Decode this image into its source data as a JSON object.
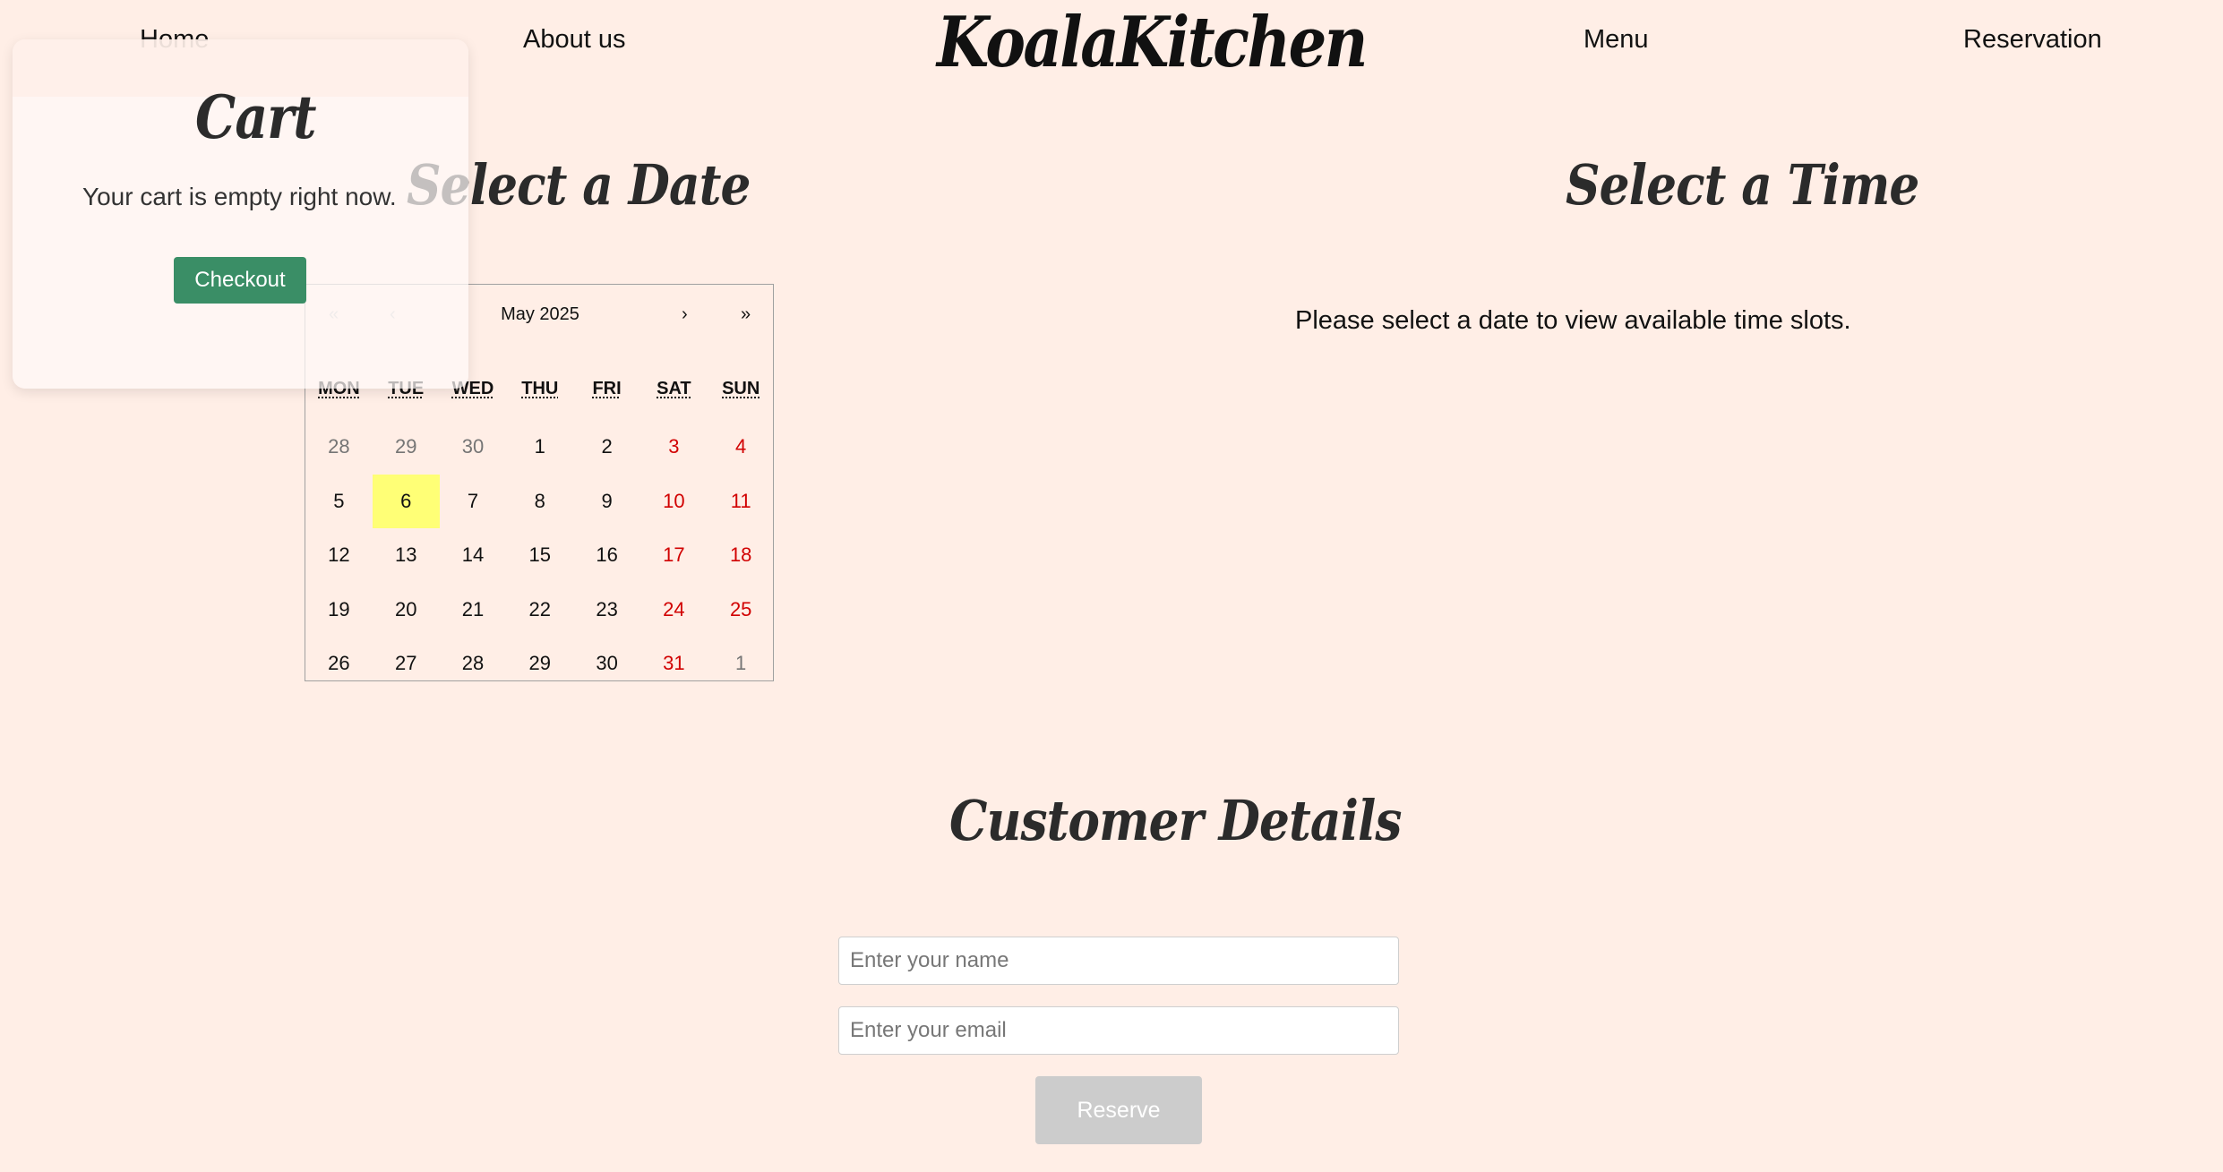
{
  "header": {
    "brand": "KoalaKitchen",
    "nav": {
      "home": "Home",
      "about": "About us",
      "menu": "Menu",
      "reservation": "Reservation"
    }
  },
  "date_section": {
    "title": "Select a Date"
  },
  "time_section": {
    "title": "Select a Time",
    "message": "Please select a date to view available time slots."
  },
  "calendar": {
    "month_label": "May 2025",
    "nav": {
      "prev_year": "«",
      "prev_month": "‹",
      "next_month": "›",
      "next_year": "»"
    },
    "weekdays": [
      "MON",
      "TUE",
      "WED",
      "THU",
      "FRI",
      "SAT",
      "SUN"
    ],
    "days": [
      {
        "label": "28",
        "kind": "other"
      },
      {
        "label": "29",
        "kind": "other"
      },
      {
        "label": "30",
        "kind": "other"
      },
      {
        "label": "1",
        "kind": "normal"
      },
      {
        "label": "2",
        "kind": "normal"
      },
      {
        "label": "3",
        "kind": "weekend"
      },
      {
        "label": "4",
        "kind": "weekend"
      },
      {
        "label": "5",
        "kind": "normal"
      },
      {
        "label": "6",
        "kind": "today"
      },
      {
        "label": "7",
        "kind": "normal"
      },
      {
        "label": "8",
        "kind": "normal"
      },
      {
        "label": "9",
        "kind": "normal"
      },
      {
        "label": "10",
        "kind": "weekend"
      },
      {
        "label": "11",
        "kind": "weekend"
      },
      {
        "label": "12",
        "kind": "normal"
      },
      {
        "label": "13",
        "kind": "normal"
      },
      {
        "label": "14",
        "kind": "normal"
      },
      {
        "label": "15",
        "kind": "normal"
      },
      {
        "label": "16",
        "kind": "normal"
      },
      {
        "label": "17",
        "kind": "weekend"
      },
      {
        "label": "18",
        "kind": "weekend"
      },
      {
        "label": "19",
        "kind": "normal"
      },
      {
        "label": "20",
        "kind": "normal"
      },
      {
        "label": "21",
        "kind": "normal"
      },
      {
        "label": "22",
        "kind": "normal"
      },
      {
        "label": "23",
        "kind": "normal"
      },
      {
        "label": "24",
        "kind": "weekend"
      },
      {
        "label": "25",
        "kind": "weekend"
      },
      {
        "label": "26",
        "kind": "normal"
      },
      {
        "label": "27",
        "kind": "normal"
      },
      {
        "label": "28",
        "kind": "normal"
      },
      {
        "label": "29",
        "kind": "normal"
      },
      {
        "label": "30",
        "kind": "normal"
      },
      {
        "label": "31",
        "kind": "weekend"
      },
      {
        "label": "1",
        "kind": "other"
      }
    ]
  },
  "cart": {
    "title": "Cart",
    "empty_message": "Your cart is empty right now.",
    "checkout_label": "Checkout"
  },
  "customer": {
    "title": "Customer Details",
    "name_placeholder": "Enter your name",
    "email_placeholder": "Enter your email",
    "reserve_label": "Reserve"
  },
  "colors": {
    "background": "#ffeee6",
    "checkout": "#3a8e66",
    "weekend": "#d10000",
    "today_highlight": "#ffff76",
    "reserve_disabled": "#cccccc"
  }
}
